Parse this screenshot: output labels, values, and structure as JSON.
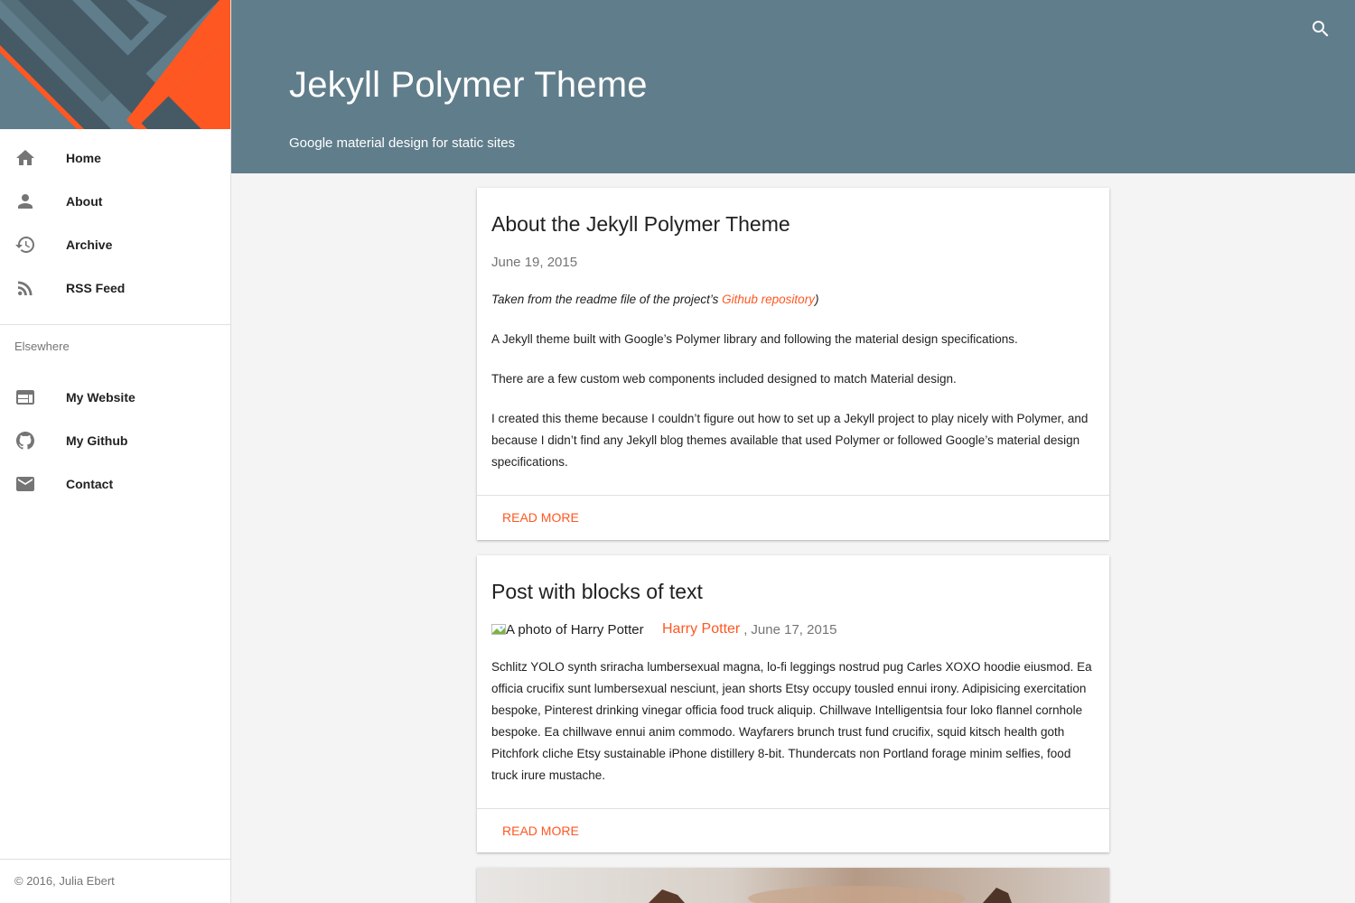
{
  "colors": {
    "accent": "#ff5722",
    "header_bg": "#607d8b",
    "banner_dark": "#455a64",
    "banner_mid": "#607d8b",
    "icon_gray": "#757575"
  },
  "sidebar": {
    "nav": [
      {
        "label": "Home",
        "icon": "home-icon"
      },
      {
        "label": "About",
        "icon": "person-icon"
      },
      {
        "label": "Archive",
        "icon": "history-icon"
      },
      {
        "label": "RSS Feed",
        "icon": "rss-icon"
      }
    ],
    "section_label": "Elsewhere",
    "elsewhere": [
      {
        "label": "My Website",
        "icon": "web-icon"
      },
      {
        "label": "My Github",
        "icon": "github-icon"
      },
      {
        "label": "Contact",
        "icon": "mail-icon"
      }
    ],
    "footer": "© 2016, Julia Ebert"
  },
  "header": {
    "title": "Jekyll Polymer Theme",
    "subtitle": "Google material design for static sites",
    "search_icon": "search-icon"
  },
  "posts": [
    {
      "title": "About the Jekyll Polymer Theme",
      "date": "June 19, 2015",
      "intro_prefix": "Taken from the readme file of the project’s ",
      "intro_link": "Github repository",
      "intro_suffix": ")",
      "paragraphs": [
        "A Jekyll theme built with Google’s Polymer library and following the material design specifications.",
        "There are a few custom web components included designed to match Material design.",
        "I created this theme because I couldn’t figure out how to set up a Jekyll project to play nicely with Polymer, and because I didn’t find any Jekyll blog themes available that used Polymer or followed Google’s material design specifications."
      ],
      "action": "READ MORE"
    },
    {
      "title": "Post with blocks of text",
      "image_alt": "A photo of Harry Potter",
      "author": "Harry Potter",
      "date_sep": ",",
      "date": "June 17, 2015",
      "body": "Schlitz YOLO synth sriracha lumbersexual magna, lo-fi leggings nostrud pug Carles XOXO hoodie eiusmod. Ea officia crucifix sunt lumbersexual nesciunt, jean shorts Etsy occupy tousled ennui irony. Adipisicing exercitation bespoke, Pinterest drinking vinegar officia food truck aliquip. Chillwave Intelligentsia four loko flannel cornhole bespoke. Ea chillwave ennui anim commodo. Wayfarers brunch trust fund crucifix, squid kitsch health goth Pitchfork cliche Etsy sustainable iPhone distillery 8-bit. Thundercats non Portland forage minim selfies, food truck irure mustache.",
      "action": "READ MORE"
    }
  ]
}
